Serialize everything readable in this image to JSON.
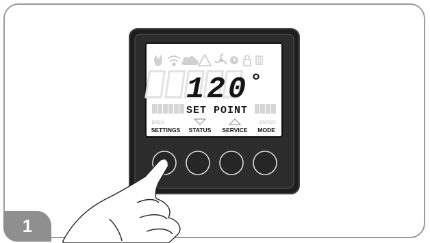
{
  "step": {
    "number": "1"
  },
  "display": {
    "value": "120",
    "unit": "°",
    "mode_text": "SET POINT"
  },
  "buttons": [
    {
      "top_label": "BACK",
      "label": "SETTINGS"
    },
    {
      "top_label": "",
      "label": "STATUS"
    },
    {
      "top_label": "",
      "label": "SERVICE"
    },
    {
      "top_label": "ENTER",
      "label": "MODE"
    }
  ],
  "icons": [
    "flame-icon",
    "wifi-icon",
    "cloud-icon",
    "warning-icon",
    "fan-icon",
    "clock-icon",
    "lock-icon",
    "heater-icon"
  ],
  "colors": {
    "bezel": "#2a2a2a",
    "lcd": "#ffffff",
    "badge": "#8f8f8f",
    "frame": "#9a9a9a"
  }
}
